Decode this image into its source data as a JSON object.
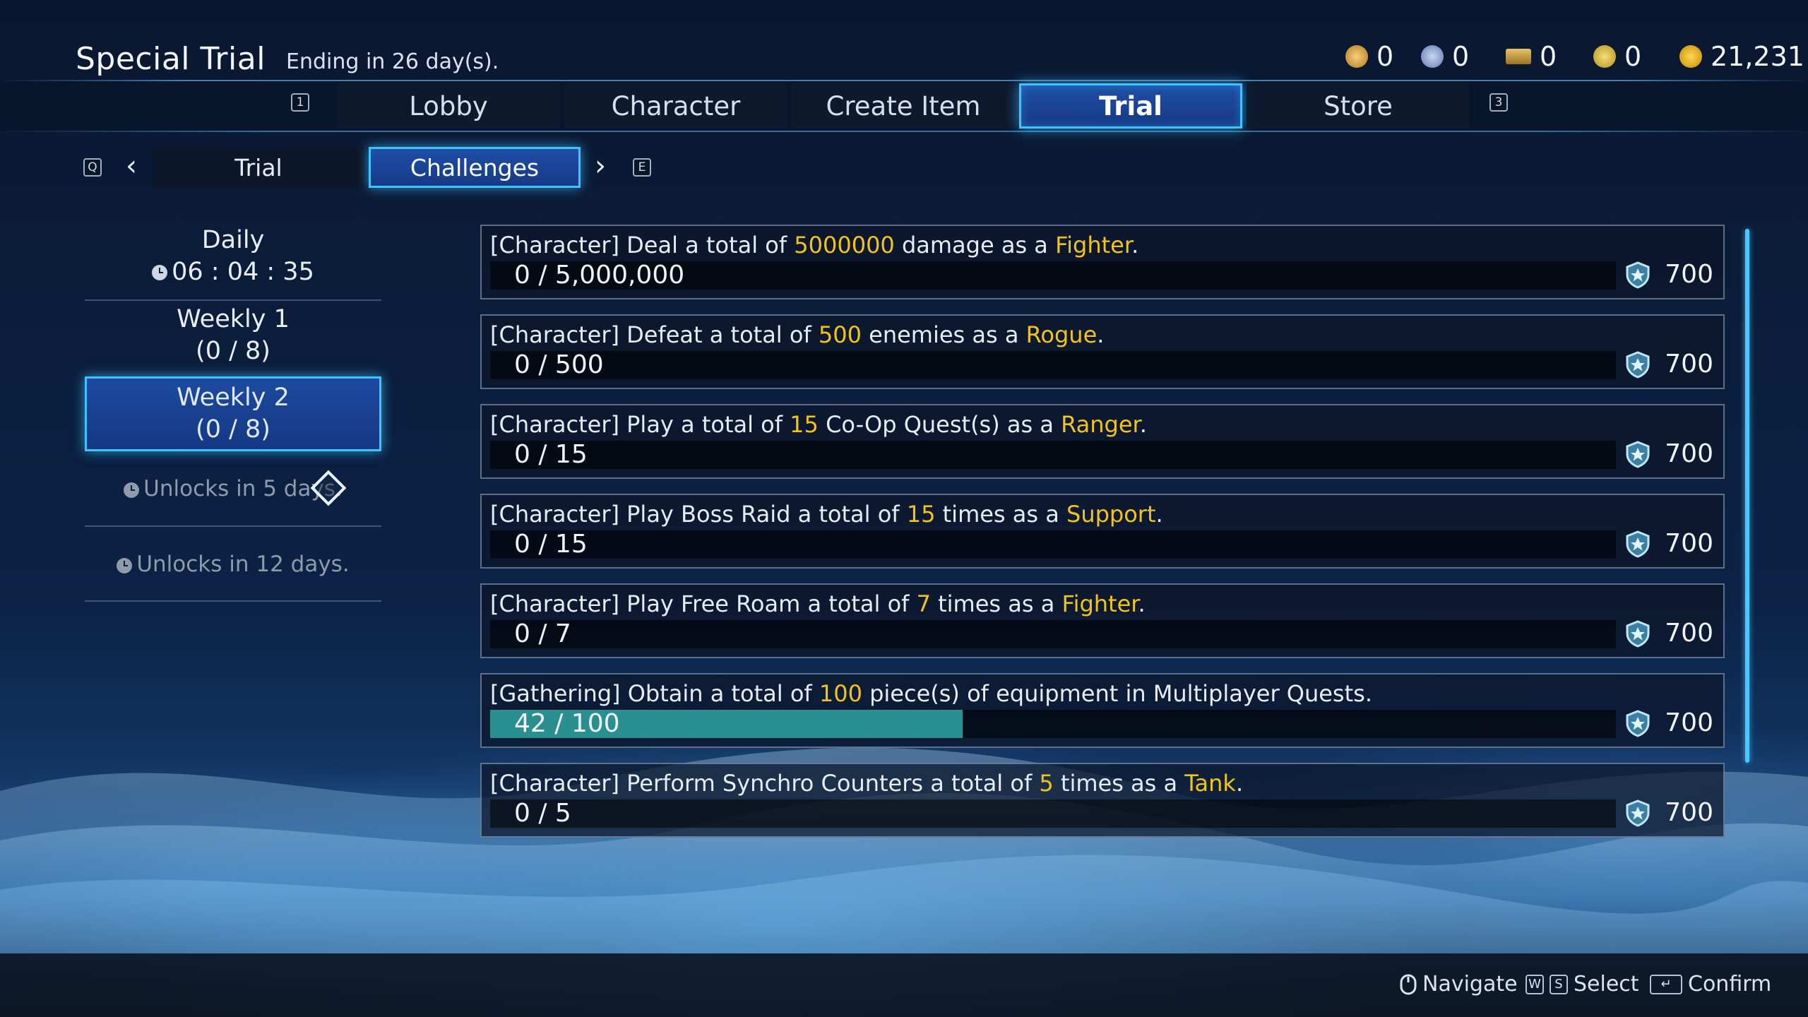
{
  "header": {
    "title": "Special Trial",
    "subtitle": "Ending in 26 day(s).",
    "currencies": [
      {
        "icon": "ticket-icon",
        "value": "0",
        "color": "#d8a640"
      },
      {
        "icon": "crystal-icon",
        "value": "0",
        "color": "#7f9bd0"
      },
      {
        "icon": "card-icon",
        "value": "0",
        "color": "#c9a24a"
      },
      {
        "icon": "silver-coin-icon",
        "value": "0",
        "color": "#d6b84a"
      },
      {
        "icon": "gold-coin-icon",
        "value": "21,231",
        "color": "#e7b21e"
      }
    ]
  },
  "tabs": {
    "left_key": "1",
    "right_key": "3",
    "items": [
      "Lobby",
      "Character",
      "Create Item",
      "Trial",
      "Store"
    ],
    "active": "Trial"
  },
  "subtabs": {
    "left_key": "Q",
    "right_key": "E",
    "items": [
      "Trial",
      "Challenges"
    ],
    "active": "Challenges"
  },
  "periods": {
    "daily": {
      "label": "Daily",
      "timer": "06 : 04 : 35"
    },
    "weekly1": {
      "label": "Weekly 1",
      "progress": "(0 / 8)"
    },
    "weekly2": {
      "label": "Weekly 2",
      "progress": "(0 / 8)"
    },
    "locked1": "Unlocks in 5 days.",
    "locked2": "Unlocks in 12 days."
  },
  "challenges": [
    {
      "pre": "[Character] Deal a total of ",
      "num": "5000000",
      "mid": " damage as a ",
      "role": "Fighter",
      "post": ".",
      "progress_text": "0 / 5,000,000",
      "progress": 0,
      "reward": "700"
    },
    {
      "pre": "[Character] Defeat a total of ",
      "num": "500",
      "mid": " enemies as a ",
      "role": "Rogue",
      "post": ".",
      "progress_text": "0 / 500",
      "progress": 0,
      "reward": "700"
    },
    {
      "pre": "[Character] Play a total of ",
      "num": "15",
      "mid": " Co-Op Quest(s) as a ",
      "role": "Ranger",
      "post": ".",
      "progress_text": "0 / 15",
      "progress": 0,
      "reward": "700"
    },
    {
      "pre": "[Character] Play Boss Raid a total of ",
      "num": "15",
      "mid": " times as a ",
      "role": "Support",
      "post": ".",
      "progress_text": "0 / 15",
      "progress": 0,
      "reward": "700"
    },
    {
      "pre": "[Character] Play Free Roam a total of ",
      "num": "7",
      "mid": " times as a ",
      "role": "Fighter",
      "post": ".",
      "progress_text": "0 / 7",
      "progress": 0,
      "reward": "700"
    },
    {
      "pre": "[Gathering] Obtain a total of ",
      "num": "100",
      "mid": " piece(s) of equipment in Multiplayer Quests.",
      "role": "",
      "post": "",
      "progress_text": "42 / 100",
      "progress": 0.42,
      "reward": "700"
    },
    {
      "pre": "[Character] Perform Synchro Counters a total of ",
      "num": "5",
      "mid": " times as a ",
      "role": "Tank",
      "post": ".",
      "progress_text": "0 / 5",
      "progress": 0,
      "reward": "700"
    }
  ],
  "footer": {
    "navigate": "Navigate",
    "select_keys": [
      "W",
      "S"
    ],
    "select": "Select",
    "confirm": "Confirm"
  },
  "colors": {
    "accent": "#3fc2ff",
    "highlight": "#f0c419",
    "progress_fill": "#2a8f90"
  }
}
